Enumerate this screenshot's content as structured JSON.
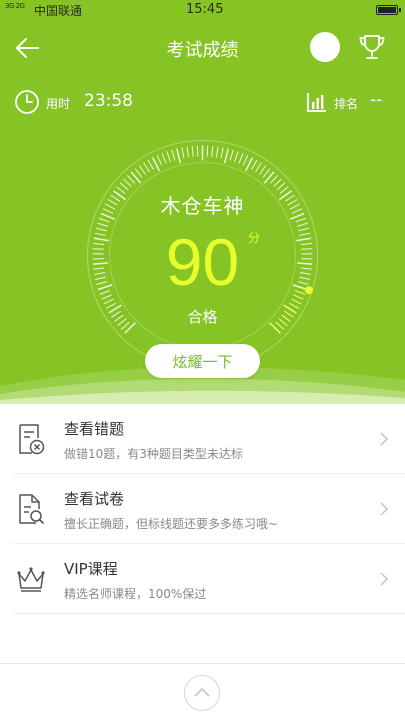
{
  "status_bar": {
    "network": "3G 2G",
    "carrier": "中国联通",
    "time": "15:45"
  },
  "nav": {
    "title": "考试成绩",
    "icons": [
      "back-arrow-icon",
      "avatar",
      "trophy-icon"
    ]
  },
  "stats": {
    "time_label": "用时",
    "time_value": "23:58",
    "rank_label": "排名",
    "rank_value": "--"
  },
  "result": {
    "user_name": "木仓车神",
    "score": "90",
    "score_unit": "分",
    "verdict": "合格",
    "score_fraction": 0.9
  },
  "share_button": "炫耀一下",
  "list": [
    {
      "icon": "wrong-questions-icon",
      "title": "查看错题",
      "subtitle": "做错10题，有3种题目类型未达标"
    },
    {
      "icon": "exam-paper-search-icon",
      "title": "查看试卷",
      "subtitle": "擅长正确题，但标线题还要多多练习哦~"
    },
    {
      "icon": "crown-icon",
      "title": "VIP课程",
      "subtitle": "精选名师课程，100%保过"
    }
  ],
  "colors": {
    "accent": "#86c426",
    "score": "#e7ff2c",
    "button_text": "#7dbd1c"
  }
}
